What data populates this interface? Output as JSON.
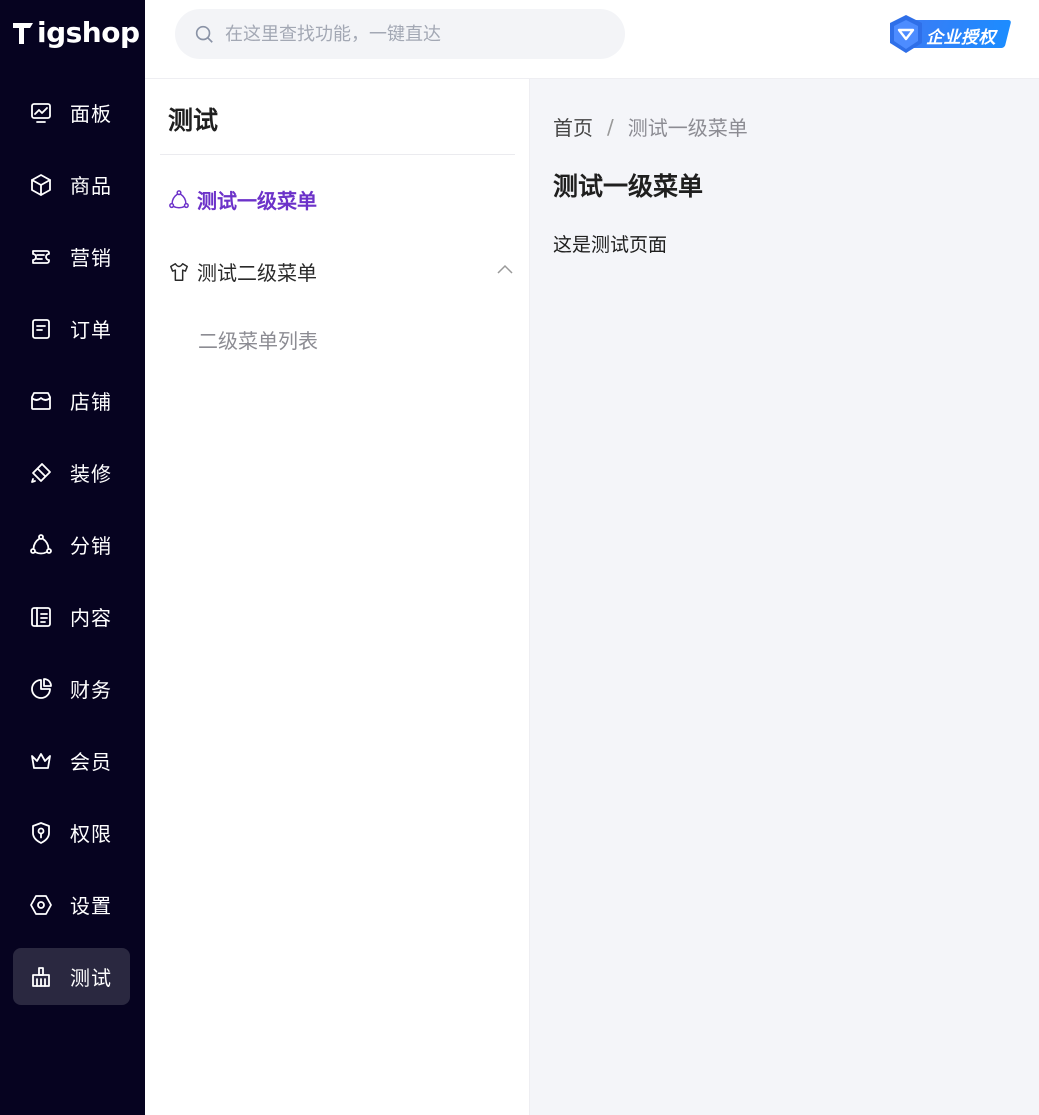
{
  "app": {
    "logo_text": "Tigshop"
  },
  "search": {
    "placeholder": "在这里查找功能，一键直达"
  },
  "badge": {
    "label": "企业授权"
  },
  "sidebar": {
    "items": [
      {
        "label": "面板",
        "icon": "dashboard-icon"
      },
      {
        "label": "商品",
        "icon": "box-icon"
      },
      {
        "label": "营销",
        "icon": "ticket-icon"
      },
      {
        "label": "订单",
        "icon": "order-icon"
      },
      {
        "label": "店铺",
        "icon": "store-icon"
      },
      {
        "label": "装修",
        "icon": "paint-icon"
      },
      {
        "label": "分销",
        "icon": "share-icon"
      },
      {
        "label": "内容",
        "icon": "content-icon"
      },
      {
        "label": "财务",
        "icon": "pie-icon"
      },
      {
        "label": "会员",
        "icon": "crown-icon"
      },
      {
        "label": "权限",
        "icon": "shield-key-icon"
      },
      {
        "label": "设置",
        "icon": "hex-settings-icon"
      },
      {
        "label": "测试",
        "icon": "broom-icon",
        "active": true
      }
    ]
  },
  "submenu": {
    "title": "测试",
    "items": [
      {
        "label": "测试一级菜单",
        "icon": "share-icon",
        "active": true
      },
      {
        "label": "测试二级菜单",
        "icon": "shirt-icon",
        "expanded": true,
        "children": [
          {
            "label": "二级菜单列表"
          }
        ]
      }
    ]
  },
  "breadcrumb": {
    "home": "首页",
    "separator": "/",
    "current": "测试一级菜单"
  },
  "content": {
    "heading": "测试一级菜单",
    "text": "这是测试页面"
  },
  "colors": {
    "sidebar_bg": "#060320",
    "accent": "#6c32c9",
    "badge": "#1c8cff",
    "content_bg": "#f4f5f9"
  }
}
